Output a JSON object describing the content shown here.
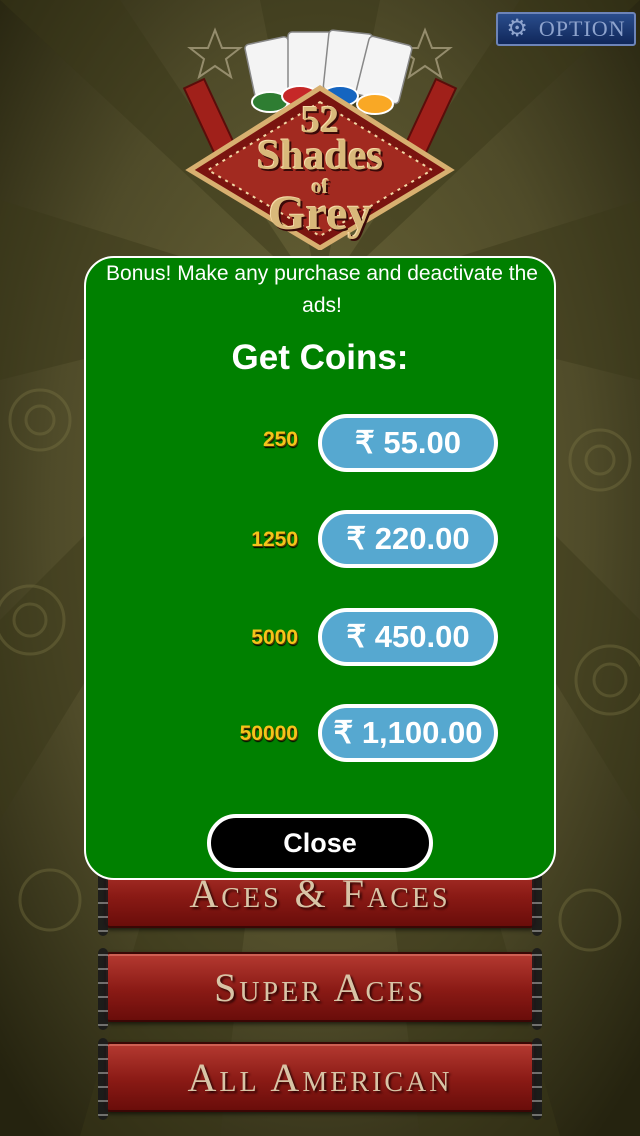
{
  "header": {
    "option_label": "OPTION",
    "option_icon": "gear-icon"
  },
  "logo": {
    "line1": "52",
    "line2": "Shades",
    "line3": "of",
    "line4": "Grey"
  },
  "menu": {
    "items": [
      "Aces & Faces",
      "Super Aces",
      "All American"
    ]
  },
  "modal": {
    "bonus_text": "Bonus! Make any purchase and deactivate the ads!",
    "title": "Get Coins:",
    "packages": [
      {
        "coins": "250",
        "price": "₹ 55.00"
      },
      {
        "coins": "1250",
        "price": "₹ 220.00"
      },
      {
        "coins": "5000",
        "price": "₹ 450.00"
      },
      {
        "coins": "50000",
        "price": "₹ 1,100.00"
      }
    ],
    "close_label": "Close"
  },
  "colors": {
    "modal_bg": "#008000",
    "price_button": "#56a8d0",
    "coin_text": "#f5c31a",
    "menu_red": "#8a1a15"
  }
}
